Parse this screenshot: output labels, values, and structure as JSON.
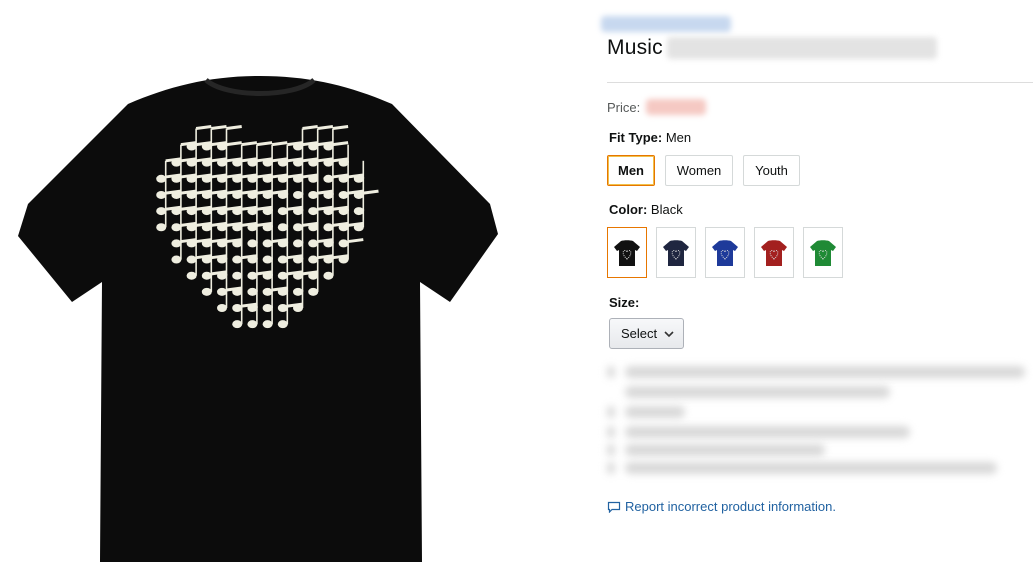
{
  "product": {
    "title_visible": "Music",
    "image_alt": "Black t-shirt with heart made of music notes"
  },
  "price": {
    "label": "Price:"
  },
  "fit_type": {
    "label": "Fit Type:",
    "selected": "Men",
    "options": [
      "Men",
      "Women",
      "Youth"
    ]
  },
  "color": {
    "label": "Color:",
    "selected": "Black",
    "swatches": [
      "#111111",
      "#1f2640",
      "#1e3a9a",
      "#a3201f",
      "#1f8a35"
    ]
  },
  "size": {
    "label": "Size:",
    "select_value": "Select"
  },
  "report": {
    "link_text": "Report incorrect product information."
  }
}
